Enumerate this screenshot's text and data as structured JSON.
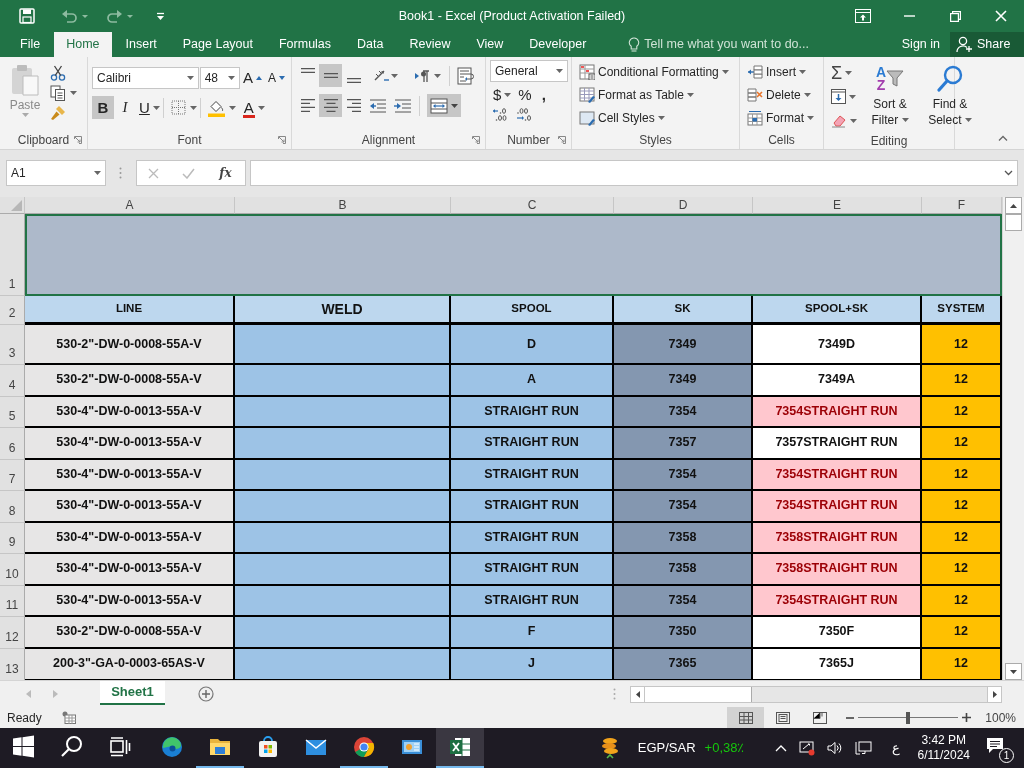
{
  "title_bar": {
    "title": "Book1 - Excel (Product Activation Failed)",
    "undo_disabled": true,
    "redo_disabled": true
  },
  "ribbon_tabs": [
    {
      "label": "File",
      "selected": false
    },
    {
      "label": "Home",
      "selected": true
    },
    {
      "label": "Insert",
      "selected": false
    },
    {
      "label": "Page Layout",
      "selected": false
    },
    {
      "label": "Formulas",
      "selected": false
    },
    {
      "label": "Data",
      "selected": false
    },
    {
      "label": "Review",
      "selected": false
    },
    {
      "label": "View",
      "selected": false
    },
    {
      "label": "Developer",
      "selected": false
    }
  ],
  "tell_me": {
    "placeholder": "Tell me what you want to do..."
  },
  "account": {
    "sign_in": "Sign in",
    "share": "Share"
  },
  "ribbon": {
    "clipboard": {
      "paste": "Paste",
      "label": "Clipboard"
    },
    "font": {
      "font_name": "Calibri",
      "font_size": "48",
      "grow": "A",
      "shrink": "A",
      "bold": {
        "label": "B",
        "pressed": true
      },
      "italic": {
        "label": "I",
        "pressed": false
      },
      "underline": {
        "label": "U",
        "pressed": false
      },
      "font_color": "A",
      "label": "Font"
    },
    "alignment": {
      "align_top": false,
      "align_middle": true,
      "align_bottom": false,
      "align_left": false,
      "align_center": true,
      "align_right": false,
      "merge_center": true,
      "label": "Alignment"
    },
    "number": {
      "format": "General",
      "currency": "$",
      "percent": "%",
      "comma": ",",
      "label": "Number"
    },
    "styles": {
      "buttons": [
        "Conditional Formatting",
        "Format as Table",
        "Cell Styles"
      ],
      "label": "Styles"
    },
    "cells": {
      "buttons": [
        "Insert",
        "Delete",
        "Format"
      ],
      "label": "Cells"
    },
    "editing": {
      "autosum": "Σ",
      "sort_filter": {
        "label": "Sort & Filter",
        "letters": [
          "A",
          "Z"
        ]
      },
      "find_select": "Find & Select",
      "label": "Editing"
    }
  },
  "formula_bar": {
    "name_box": "A1",
    "function_label": "fx"
  },
  "sheet": {
    "columns": [
      "A",
      "B",
      "C",
      "D",
      "E",
      "F"
    ],
    "banner": {
      "row": "1",
      "selected": true
    },
    "header": {
      "row": "2",
      "cells": [
        "LINE",
        "WELD",
        "SPOOL",
        "SK",
        "SPOOL+SK",
        "SYSTEM"
      ]
    },
    "rows": [
      {
        "row": "3",
        "line": "530-2\"-DW-0-0008-55A-V",
        "spool": "D",
        "sk": "7349",
        "spool_sk": "7349D",
        "duplicate": false,
        "system": "12"
      },
      {
        "row": "4",
        "line": "530-2\"-DW-0-0008-55A-V",
        "spool": "A",
        "sk": "7349",
        "spool_sk": "7349A",
        "duplicate": false,
        "system": "12"
      },
      {
        "row": "5",
        "line": "530-4\"-DW-0-0013-55A-V",
        "spool": "STRAIGHT RUN",
        "sk": "7354",
        "spool_sk": "7354STRAIGHT RUN",
        "duplicate": true,
        "system": "12"
      },
      {
        "row": "6",
        "line": "530-4\"-DW-0-0013-55A-V",
        "spool": "STRAIGHT RUN",
        "sk": "7357",
        "spool_sk": "7357STRAIGHT RUN",
        "duplicate": false,
        "system": "12"
      },
      {
        "row": "7",
        "line": "530-4\"-DW-0-0013-55A-V",
        "spool": "STRAIGHT RUN",
        "sk": "7354",
        "spool_sk": "7354STRAIGHT RUN",
        "duplicate": true,
        "system": "12"
      },
      {
        "row": "8",
        "line": "530-4\"-DW-0-0013-55A-V",
        "spool": "STRAIGHT RUN",
        "sk": "7354",
        "spool_sk": "7354STRAIGHT RUN",
        "duplicate": true,
        "system": "12"
      },
      {
        "row": "9",
        "line": "530-4\"-DW-0-0013-55A-V",
        "spool": "STRAIGHT RUN",
        "sk": "7358",
        "spool_sk": "7358STRAIGHT RUN",
        "duplicate": true,
        "system": "12"
      },
      {
        "row": "10",
        "line": "530-4\"-DW-0-0013-55A-V",
        "spool": "STRAIGHT RUN",
        "sk": "7358",
        "spool_sk": "7358STRAIGHT RUN",
        "duplicate": true,
        "system": "12"
      },
      {
        "row": "11",
        "line": "530-4\"-DW-0-0013-55A-V",
        "spool": "STRAIGHT RUN",
        "sk": "7354",
        "spool_sk": "7354STRAIGHT RUN",
        "duplicate": true,
        "system": "12"
      },
      {
        "row": "12",
        "line": "530-2\"-DW-0-0008-55A-V",
        "spool": "F",
        "sk": "7350",
        "spool_sk": "7350F",
        "duplicate": false,
        "system": "12"
      },
      {
        "row": "13",
        "line": "200-3\"-GA-0-0003-65AS-V",
        "spool": "J",
        "sk": "7365",
        "spool_sk": "7365J",
        "duplicate": false,
        "system": "12"
      }
    ]
  },
  "sheet_tabs": [
    {
      "label": "Sheet1",
      "selected": true
    }
  ],
  "status_bar": {
    "status": "Ready",
    "normal_view": true,
    "page_layout_view": false,
    "page_break_view": false,
    "zoom": {
      "level": 0.5,
      "reading": "100%"
    }
  },
  "taskbar": {
    "apps": [
      {
        "kind": "start",
        "running": false,
        "active": false
      },
      {
        "kind": "search",
        "running": false,
        "active": false
      },
      {
        "kind": "task_view",
        "running": false,
        "active": false
      },
      {
        "kind": "edge",
        "running": false,
        "active": false
      },
      {
        "kind": "explorer",
        "running": true,
        "active": false
      },
      {
        "kind": "store",
        "running": false,
        "active": false
      },
      {
        "kind": "mail",
        "running": false,
        "active": false
      },
      {
        "kind": "chrome",
        "running": true,
        "active": false
      },
      {
        "kind": "app",
        "running": false,
        "active": false
      },
      {
        "kind": "excel",
        "running": true,
        "active": true
      }
    ],
    "ticker": {
      "pair": "EGP/SAR",
      "change": "+0,38٪"
    },
    "language": "ع",
    "time": "3:42 PM",
    "date": "6/11/2024",
    "notifications": {
      "count": "1"
    }
  }
}
